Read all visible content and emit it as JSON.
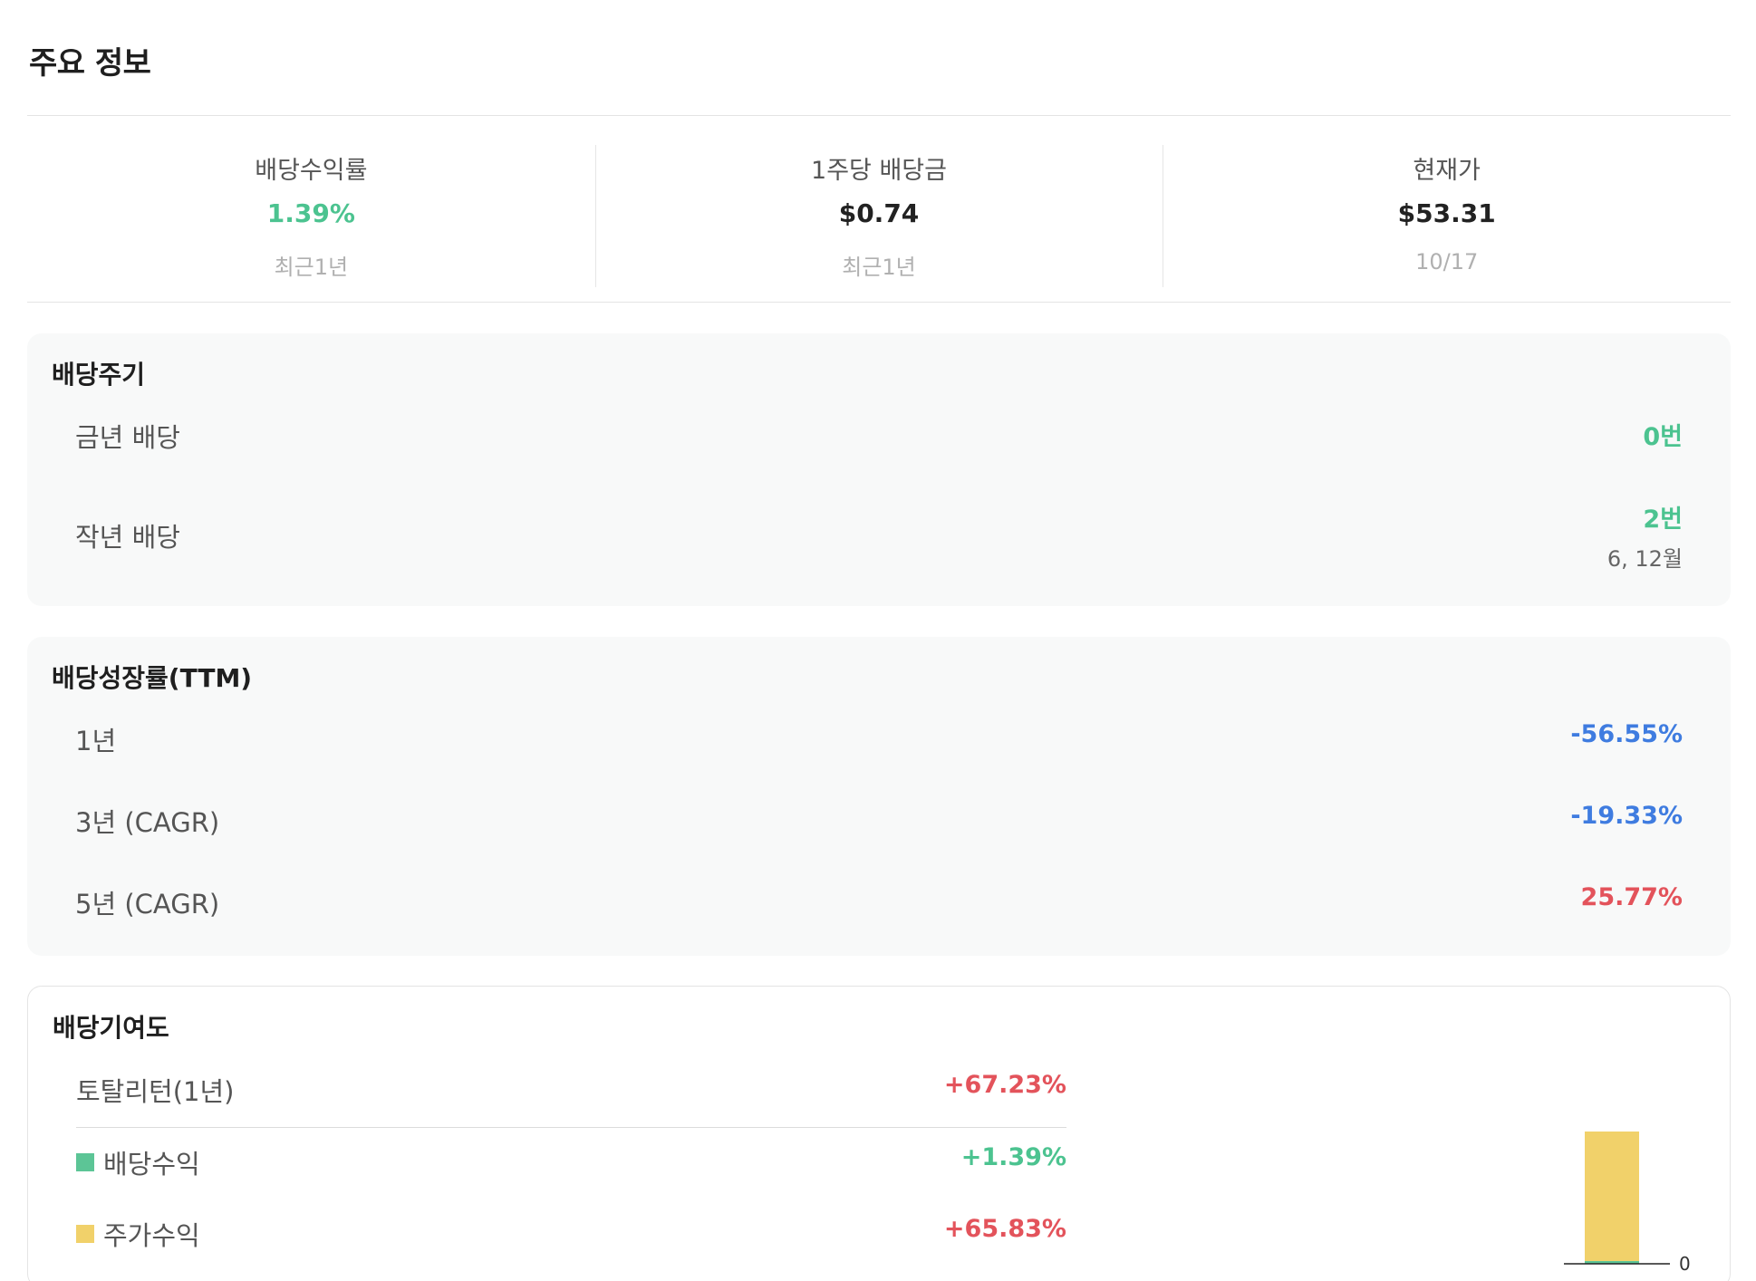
{
  "page_title": "주요 정보",
  "summary": [
    {
      "label": "배당수익률",
      "value": "1.39%",
      "sub": "최근1년"
    },
    {
      "label": "1주당 배당금",
      "value": "$0.74",
      "sub": "최근1년"
    },
    {
      "label": "현재가",
      "value": "$53.31",
      "sub": "10/17"
    }
  ],
  "dividend_cycle": {
    "title": "배당주기",
    "rows": [
      {
        "label": "금년 배당",
        "value": "0번"
      },
      {
        "label": "작년 배당",
        "value": "2번",
        "sub": "6, 12월"
      }
    ]
  },
  "dividend_growth": {
    "title": "배당성장률(TTM)",
    "rows": [
      {
        "label": "1년",
        "value": "-56.55%"
      },
      {
        "label": "3년 (CAGR)",
        "value": "-19.33%"
      },
      {
        "label": "5년 (CAGR)",
        "value": "25.77%"
      }
    ]
  },
  "contribution": {
    "title": "배당기여도",
    "total": {
      "label": "토탈리턴(1년)",
      "value": "+67.23%"
    },
    "items": [
      {
        "label": "배당수익",
        "value": "+1.39%"
      },
      {
        "label": "주가수익",
        "value": "+65.83%"
      }
    ]
  },
  "colors": {
    "green": "#4cc390",
    "blue": "#3f7ce0",
    "red": "#e3535b",
    "dividend_swatch": "#5cc596",
    "price_swatch": "#f1d16a"
  },
  "chart_data": {
    "type": "bar",
    "stacked": true,
    "categories": [
      ""
    ],
    "series": [
      {
        "name": "배당수익",
        "values": [
          1.39
        ]
      },
      {
        "name": "주가수익",
        "values": [
          65.83
        ]
      }
    ],
    "baseline_label": "0"
  }
}
